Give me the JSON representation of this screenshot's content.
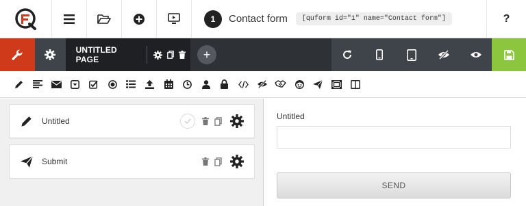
{
  "topbar": {
    "form_number": "1",
    "form_name": "Contact form",
    "shortcode": "[quform id=\"1\" name=\"Contact form\"]",
    "help_label": "?",
    "icons": [
      "quform-logo-icon",
      "menu-icon",
      "folder-open-icon",
      "plus-circle-icon",
      "preview-screen-icon"
    ]
  },
  "pagebar": {
    "page_title": "UNTITLED PAGE",
    "add_label": "+",
    "icons": [
      "wrench-icon",
      "gear-icon",
      "refresh-icon",
      "phone-view-icon",
      "tablet-view-icon",
      "hide-icon",
      "eye-icon",
      "save-icon"
    ]
  },
  "element_toolbar": {
    "icons": [
      "pencil-icon",
      "text-lines-icon",
      "email-icon",
      "select-icon",
      "checkbox-icon",
      "radio-icon",
      "list-icon",
      "upload-icon",
      "calendar-icon",
      "clock-icon",
      "user-icon",
      "lock-icon",
      "code-icon",
      "hidden-eye-icon",
      "handshake-icon",
      "captcha-face-icon",
      "send-icon",
      "group-icon",
      "columns-icon"
    ]
  },
  "elements": [
    {
      "label": "Untitled",
      "icon": "pencil-icon"
    },
    {
      "label": "Submit",
      "icon": "send-icon"
    }
  ],
  "preview": {
    "field_label": "Untitled",
    "field_value": "",
    "submit_label": "SEND"
  },
  "colors": {
    "tools_red": "#cf3a1a",
    "save_green": "#8cc63f",
    "dark_bar": "#3f434a",
    "page_bar": "#1e2023"
  }
}
